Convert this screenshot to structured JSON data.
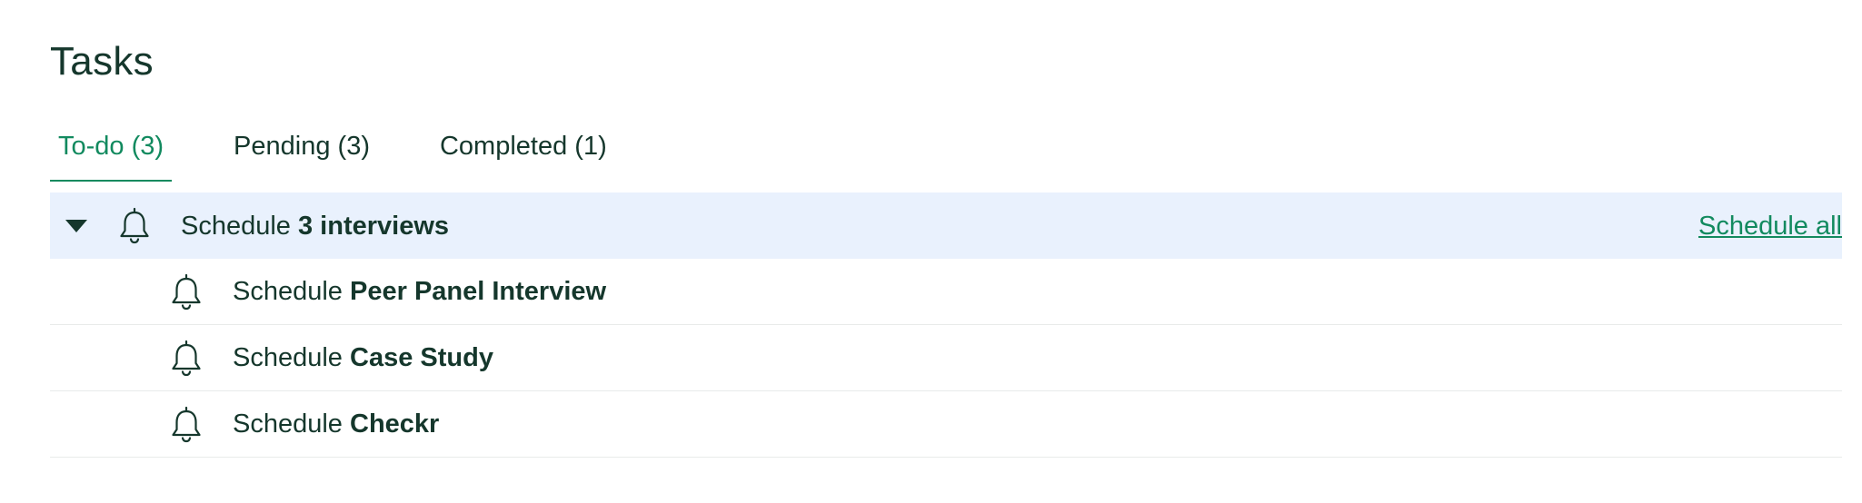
{
  "page": {
    "title": "Tasks"
  },
  "tabs": [
    {
      "label": "To-do (3)",
      "active": true
    },
    {
      "label": "Pending (3)",
      "active": false
    },
    {
      "label": "Completed (1)",
      "active": false
    }
  ],
  "group": {
    "prefix": "Schedule",
    "label": "3 interviews",
    "action": "Schedule all",
    "expanded": true,
    "icon": "bell-icon",
    "toggle_icon": "caret-down-icon"
  },
  "tasks": [
    {
      "prefix": "Schedule",
      "label": "Peer Panel Interview",
      "icon": "bell-icon"
    },
    {
      "prefix": "Schedule",
      "label": "Case Study",
      "icon": "bell-icon"
    },
    {
      "prefix": "Schedule",
      "label": "Checkr",
      "icon": "bell-icon"
    }
  ],
  "colors": {
    "text": "#15372c",
    "accent": "#128a5f",
    "group_background": "#e9f1fd",
    "divider": "#e8ebea"
  }
}
